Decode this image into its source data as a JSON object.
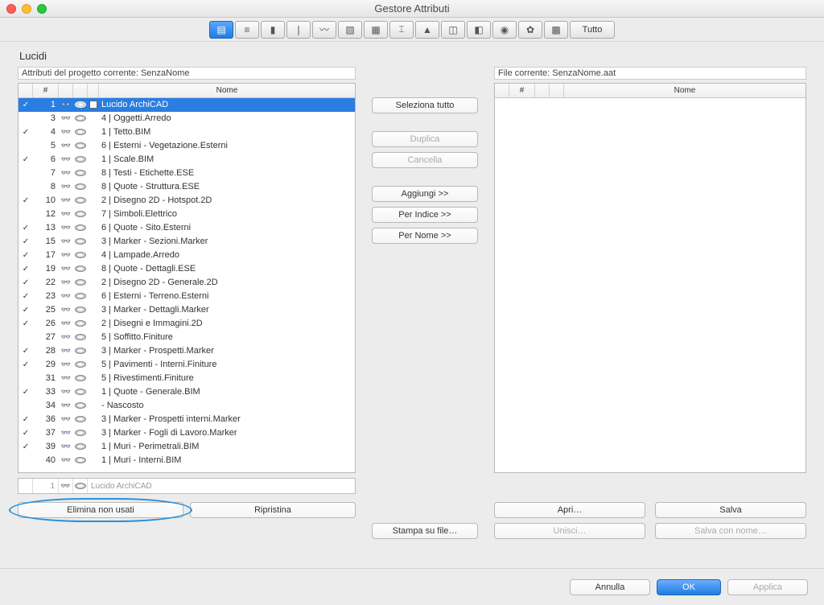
{
  "window": {
    "title": "Gestore Attributi"
  },
  "section": {
    "label": "Lucidi"
  },
  "toolbar": {
    "tutto": "Tutto"
  },
  "left": {
    "subtitle_prefix": "Attributi del progetto corrente: ",
    "subtitle_name": "SenzaNome",
    "headers": {
      "num": "#",
      "name": "Nome"
    },
    "rows": [
      {
        "chk": true,
        "num": "1",
        "name": "Lucido ArchiCAD",
        "sel": true,
        "lock": true
      },
      {
        "chk": false,
        "num": "3",
        "name": "4 | Oggetti.Arredo"
      },
      {
        "chk": true,
        "num": "4",
        "name": "1 | Tetto.BIM"
      },
      {
        "chk": false,
        "num": "5",
        "name": "6 | Esterni - Vegetazione.Esterni"
      },
      {
        "chk": true,
        "num": "6",
        "name": "1 | Scale.BIM"
      },
      {
        "chk": false,
        "num": "7",
        "name": "8 | Testi - Etichette.ESE"
      },
      {
        "chk": false,
        "num": "8",
        "name": "8 | Quote - Struttura.ESE"
      },
      {
        "chk": true,
        "num": "10",
        "name": "2 | Disegno 2D - Hotspot.2D"
      },
      {
        "chk": false,
        "num": "12",
        "name": "7 | Simboli.Elettrico"
      },
      {
        "chk": true,
        "num": "13",
        "name": "6 | Quote - Sito.Esterni"
      },
      {
        "chk": true,
        "num": "15",
        "name": "3 | Marker - Sezioni.Marker"
      },
      {
        "chk": true,
        "num": "17",
        "name": "4 | Lampade.Arredo"
      },
      {
        "chk": true,
        "num": "19",
        "name": "8 | Quote - Dettagli.ESE"
      },
      {
        "chk": true,
        "num": "22",
        "name": "2 | Disegno 2D - Generale.2D"
      },
      {
        "chk": true,
        "num": "23",
        "name": "6 | Esterni - Terreno.Esterni"
      },
      {
        "chk": true,
        "num": "25",
        "name": "3 | Marker - Dettagli.Marker"
      },
      {
        "chk": true,
        "num": "26",
        "name": "2 | Disegni e Immagini.2D"
      },
      {
        "chk": false,
        "num": "27",
        "name": "5 | Soffitto.Finiture"
      },
      {
        "chk": true,
        "num": "28",
        "name": "3 | Marker - Prospetti.Marker"
      },
      {
        "chk": true,
        "num": "29",
        "name": "5 | Pavimenti - Interni.Finiture"
      },
      {
        "chk": false,
        "num": "31",
        "name": "5 | Rivestimenti.Finiture"
      },
      {
        "chk": true,
        "num": "33",
        "name": "1 | Quote - Generale.BIM"
      },
      {
        "chk": false,
        "num": "34",
        "name": "- Nascosto"
      },
      {
        "chk": true,
        "num": "36",
        "name": "3 | Marker - Prospetti interni.Marker"
      },
      {
        "chk": true,
        "num": "37",
        "name": "3 | Marker - Fogli di Lavoro.Marker"
      },
      {
        "chk": true,
        "num": "39",
        "name": "1 | Muri - Perimetrali.BIM"
      },
      {
        "chk": false,
        "num": "40",
        "name": "1 | Muri - Interni.BIM"
      }
    ],
    "input": {
      "num": "1",
      "placeholder": "Lucido ArchiCAD"
    },
    "buttons": {
      "elimina": "Elimina non usati",
      "ripristina": "Ripristina"
    }
  },
  "mid": {
    "seleziona": "Seleziona tutto",
    "duplica": "Duplica",
    "cancella": "Cancella",
    "aggiungi": "Aggiungi >>",
    "per_indice": "Per Indice >>",
    "per_nome": "Per Nome >>",
    "stampa": "Stampa su file…"
  },
  "right": {
    "subtitle_prefix": "File corrente: ",
    "subtitle_name": "SenzaNome.aat",
    "headers": {
      "num": "#",
      "name": "Nome"
    },
    "buttons": {
      "apri": "Apri…",
      "salva": "Salva",
      "unisci": "Unisci…",
      "salva_nome": "Salva con nome…"
    }
  },
  "footer": {
    "annulla": "Annulla",
    "ok": "OK",
    "applica": "Applica"
  }
}
